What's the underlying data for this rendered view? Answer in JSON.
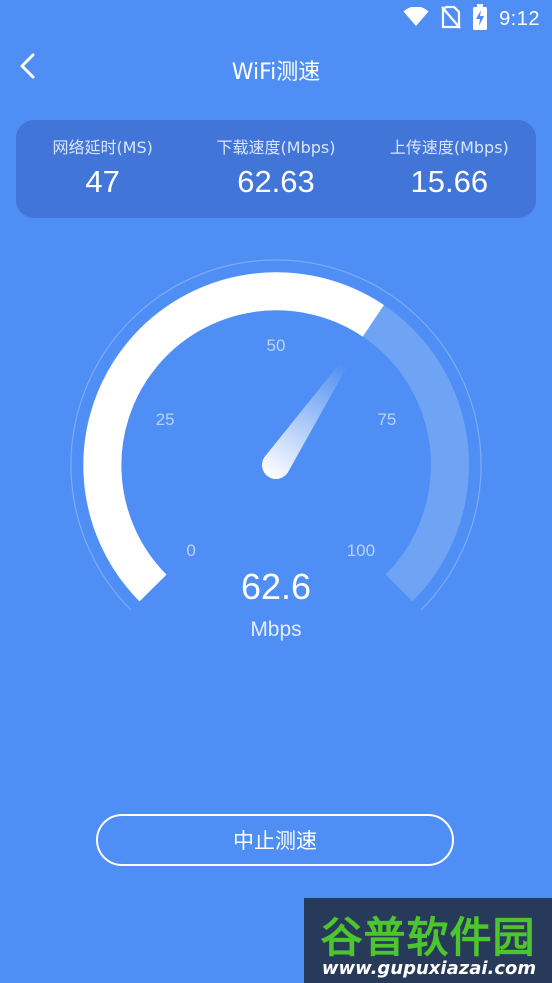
{
  "status_bar": {
    "time": "9:12",
    "icons": [
      "wifi-icon",
      "no-sim-icon",
      "battery-charging-icon"
    ]
  },
  "app_bar": {
    "back_icon": "chevron-left-icon",
    "title": "WiFi测速"
  },
  "stats": [
    {
      "label": "网络延时(MS)",
      "value": "47"
    },
    {
      "label": "下载速度(Mbps)",
      "value": "62.63"
    },
    {
      "label": "上传速度(Mbps)",
      "value": "15.66"
    }
  ],
  "gauge": {
    "value": "62.6",
    "unit": "Mbps",
    "ticks": [
      "0",
      "25",
      "50",
      "75",
      "100"
    ],
    "min": 0,
    "max": 100,
    "reading": 62.6,
    "colors": {
      "fill": "#ffffff",
      "track": "#6fa3f4",
      "needle_tip": "#4d8cf2"
    }
  },
  "actions": {
    "stop_label": "中止测速"
  },
  "watermark": {
    "title": "谷普软件园",
    "url": "www.gupuxiazai.com"
  },
  "colors": {
    "background": "#4f8ff5",
    "card": "#4275d8",
    "text": "#ffffff"
  }
}
